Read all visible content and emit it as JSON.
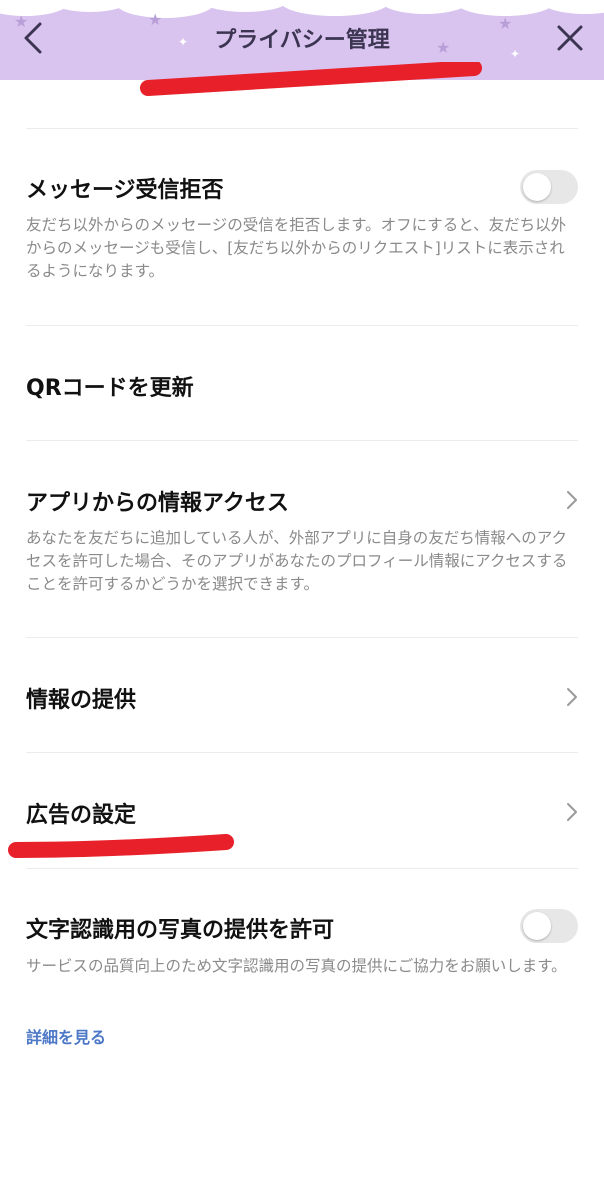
{
  "header": {
    "title": "プライバシー管理",
    "background_color": "#d9c4ef",
    "back_icon": "chevron-left-icon",
    "close_icon": "close-icon"
  },
  "items": [
    {
      "title": "メッセージ受信拒否",
      "description": "友だち以外からのメッセージの受信を拒否します。オフにすると、友だち以外からのメッセージも受信し、[友だち以外からのリクエスト]リストに表示されるようになります。",
      "control": "toggle",
      "toggle_on": false
    },
    {
      "title": "QRコードを更新",
      "control": "none"
    },
    {
      "title": "アプリからの情報アクセス",
      "description": "あなたを友だちに追加している人が、外部アプリに自身の友だち情報へのアクセスを許可した場合、そのアプリがあなたのプロフィール情報にアクセスすることを許可するかどうかを選択できます。",
      "control": "chevron"
    },
    {
      "title": "情報の提供",
      "control": "chevron"
    },
    {
      "title": "広告の設定",
      "control": "chevron"
    },
    {
      "title": "文字認識用の写真の提供を許可",
      "description": "サービスの品質向上のため文字認識用の写真の提供にご協力をお願いします。",
      "control": "toggle",
      "toggle_on": false,
      "link": "詳細を見る"
    }
  ],
  "colors": {
    "link": "#4d78c7",
    "description": "#8a8a8a",
    "annotation": "#e8202a",
    "toggle_off": "#e7e7e7"
  }
}
